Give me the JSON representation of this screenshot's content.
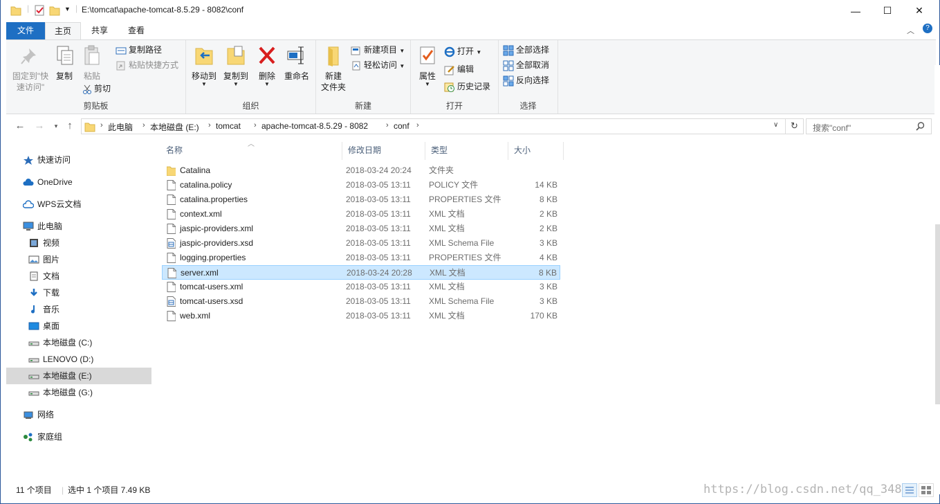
{
  "window": {
    "title": "E:\\tomcat\\apache-tomcat-8.5.29 - 8082\\conf",
    "minimize": "—",
    "maximize": "☐",
    "close": "✕"
  },
  "ribbon_tabs": [
    "文件",
    "主页",
    "共享",
    "查看"
  ],
  "ribbon": {
    "clipboard": {
      "label": "剪贴板",
      "pin": "固定到\"快\n速访问\"",
      "copy": "复制",
      "paste": "粘贴",
      "copy_path": "复制路径",
      "paste_shortcut": "粘贴快捷方式",
      "cut": "剪切"
    },
    "organize": {
      "label": "组织",
      "move_to": "移动到",
      "copy_to": "复制到",
      "delete": "删除",
      "rename": "重命名"
    },
    "new": {
      "label": "新建",
      "new_folder": "新建\n文件夹",
      "new_item": "新建项目",
      "easy_access": "轻松访问"
    },
    "open": {
      "label": "打开",
      "properties": "属性",
      "open": "打开",
      "edit": "编辑",
      "history": "历史记录"
    },
    "select": {
      "label": "选择",
      "select_all": "全部选择",
      "select_none": "全部取消",
      "invert": "反向选择"
    }
  },
  "address": {
    "crumbs": [
      "此电脑",
      "本地磁盘 (E:)",
      "tomcat",
      "apache-tomcat-8.5.29 - 8082",
      "conf"
    ],
    "search_placeholder": "搜索\"conf\""
  },
  "nav": [
    {
      "label": "快速访问",
      "icon": "star-icon"
    },
    {
      "label": "OneDrive",
      "icon": "cloud-icon"
    },
    {
      "label": "WPS云文档",
      "icon": "cloud-outline-icon"
    },
    {
      "label": "此电脑",
      "icon": "computer-icon"
    },
    {
      "label": "视频",
      "icon": "video-icon"
    },
    {
      "label": "图片",
      "icon": "picture-icon"
    },
    {
      "label": "文档",
      "icon": "document-icon"
    },
    {
      "label": "下载",
      "icon": "download-icon"
    },
    {
      "label": "音乐",
      "icon": "music-icon"
    },
    {
      "label": "桌面",
      "icon": "desktop-icon"
    },
    {
      "label": "本地磁盘 (C:)",
      "icon": "drive-icon"
    },
    {
      "label": "LENOVO (D:)",
      "icon": "drive-icon"
    },
    {
      "label": "本地磁盘 (E:)",
      "icon": "drive-icon"
    },
    {
      "label": "本地磁盘 (G:)",
      "icon": "drive-icon"
    },
    {
      "label": "网络",
      "icon": "network-icon"
    },
    {
      "label": "家庭组",
      "icon": "homegroup-icon"
    }
  ],
  "columns": [
    "名称",
    "修改日期",
    "类型",
    "大小"
  ],
  "files": [
    {
      "name": "Catalina",
      "date": "2018-03-24 20:24",
      "type": "文件夹",
      "size": "",
      "icon": "folder-icon"
    },
    {
      "name": "catalina.policy",
      "date": "2018-03-05 13:11",
      "type": "POLICY 文件",
      "size": "14 KB",
      "icon": "file-icon"
    },
    {
      "name": "catalina.properties",
      "date": "2018-03-05 13:11",
      "type": "PROPERTIES 文件",
      "size": "8 KB",
      "icon": "file-icon"
    },
    {
      "name": "context.xml",
      "date": "2018-03-05 13:11",
      "type": "XML 文档",
      "size": "2 KB",
      "icon": "file-icon"
    },
    {
      "name": "jaspic-providers.xml",
      "date": "2018-03-05 13:11",
      "type": "XML 文档",
      "size": "2 KB",
      "icon": "file-icon"
    },
    {
      "name": "jaspic-providers.xsd",
      "date": "2018-03-05 13:11",
      "type": "XML Schema File",
      "size": "3 KB",
      "icon": "schema-file-icon"
    },
    {
      "name": "logging.properties",
      "date": "2018-03-05 13:11",
      "type": "PROPERTIES 文件",
      "size": "4 KB",
      "icon": "file-icon"
    },
    {
      "name": "server.xml",
      "date": "2018-03-24 20:28",
      "type": "XML 文档",
      "size": "8 KB",
      "icon": "file-icon"
    },
    {
      "name": "tomcat-users.xml",
      "date": "2018-03-05 13:11",
      "type": "XML 文档",
      "size": "3 KB",
      "icon": "file-icon"
    },
    {
      "name": "tomcat-users.xsd",
      "date": "2018-03-05 13:11",
      "type": "XML Schema File",
      "size": "3 KB",
      "icon": "schema-file-icon"
    },
    {
      "name": "web.xml",
      "date": "2018-03-05 13:11",
      "type": "XML 文档",
      "size": "170 KB",
      "icon": "file-icon"
    }
  ],
  "selected_file": "server.xml",
  "status": {
    "count": "11 个项目",
    "selection": "选中 1 个项目  7.49 KB"
  },
  "watermark": "https://blog.csdn.net/qq_3489",
  "colors": {
    "accent": "#1e6fc3",
    "selection": "#cce8ff",
    "selection_border": "#99d1ff",
    "folder": "#f8d775"
  }
}
